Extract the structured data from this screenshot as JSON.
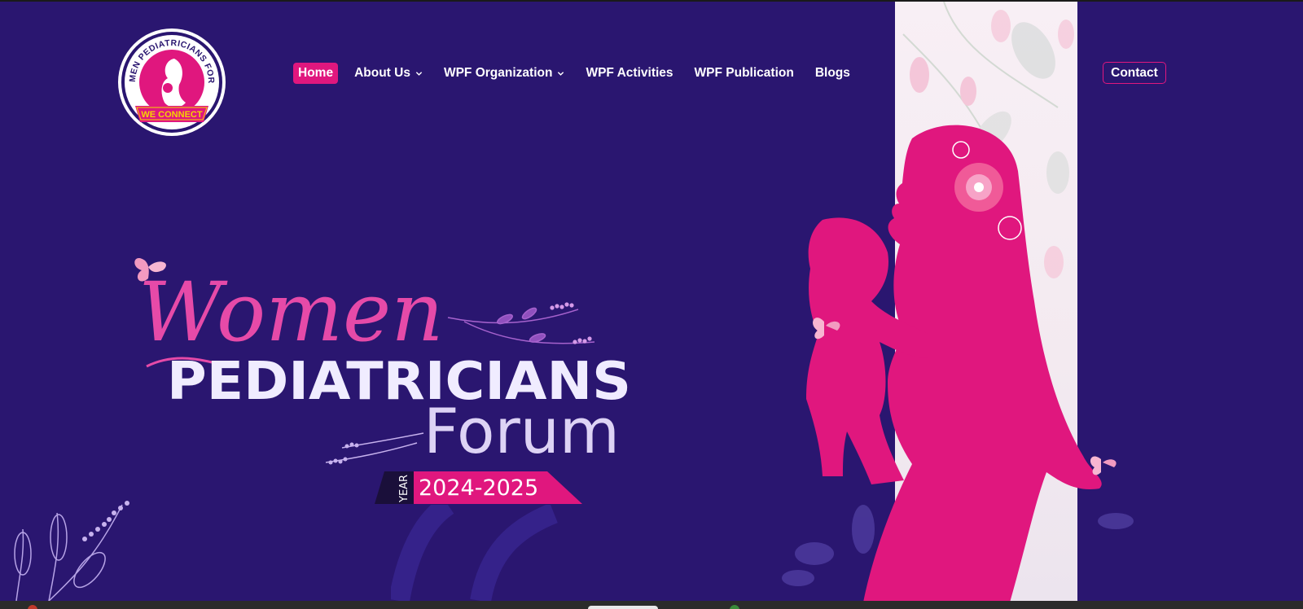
{
  "brand": {
    "logo_ring_text": "WOMEN PEDIATRICIANS FORUM",
    "logo_ribbon_text": "WE CONNECT"
  },
  "nav": {
    "items": [
      {
        "label": "Home",
        "active": true,
        "dropdown": false
      },
      {
        "label": "About Us",
        "active": false,
        "dropdown": true
      },
      {
        "label": "WPF Organization",
        "active": false,
        "dropdown": true
      },
      {
        "label": "WPF Activities",
        "active": false,
        "dropdown": false
      },
      {
        "label": "WPF Publication",
        "active": false,
        "dropdown": false
      },
      {
        "label": "Blogs",
        "active": false,
        "dropdown": false
      }
    ],
    "contact_label": "Contact"
  },
  "hero": {
    "script_word": "Women",
    "main_word": "PEDIATRICIANS",
    "sub_word": "Forum",
    "year_label": "YEAR",
    "year_value": "2024-2025"
  },
  "colors": {
    "background": "#2a1670",
    "accent": "#e0177e",
    "strip": "#f6eef4"
  },
  "icons": {
    "dropdown": "chevron-down-icon",
    "butterfly": "butterfly-icon"
  }
}
